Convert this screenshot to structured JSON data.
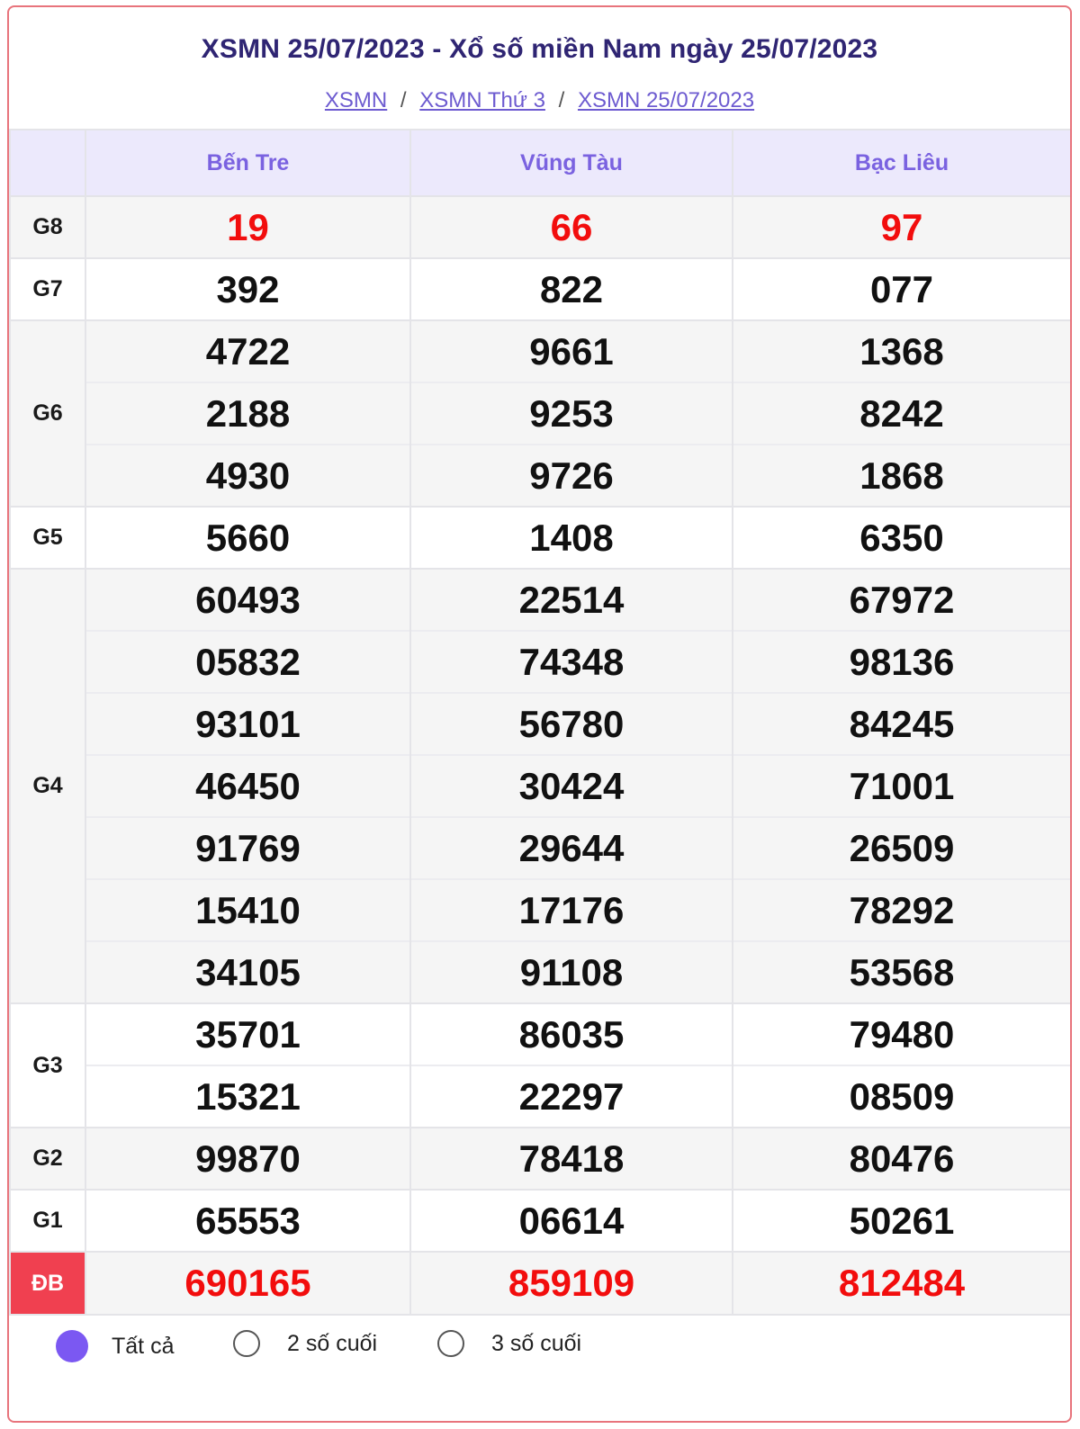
{
  "header": {
    "title": "XSMN 25/07/2023 - Xổ số miền Nam ngày 25/07/2023",
    "breadcrumb": [
      "XSMN",
      "XSMN Thứ 3",
      "XSMN 25/07/2023"
    ],
    "separator": "/"
  },
  "table": {
    "provinces": [
      "Bến Tre",
      "Vũng Tàu",
      "Bạc Liêu"
    ],
    "rows": [
      {
        "label": "G8",
        "red": true,
        "values": [
          [
            "19"
          ],
          [
            "66"
          ],
          [
            "97"
          ]
        ]
      },
      {
        "label": "G7",
        "values": [
          [
            "392"
          ],
          [
            "822"
          ],
          [
            "077"
          ]
        ]
      },
      {
        "label": "G6",
        "values": [
          [
            "4722",
            "2188",
            "4930"
          ],
          [
            "9661",
            "9253",
            "9726"
          ],
          [
            "1368",
            "8242",
            "1868"
          ]
        ]
      },
      {
        "label": "G5",
        "values": [
          [
            "5660"
          ],
          [
            "1408"
          ],
          [
            "6350"
          ]
        ]
      },
      {
        "label": "G4",
        "values": [
          [
            "60493",
            "05832",
            "93101",
            "46450",
            "91769",
            "15410",
            "34105"
          ],
          [
            "22514",
            "74348",
            "56780",
            "30424",
            "29644",
            "17176",
            "91108"
          ],
          [
            "67972",
            "98136",
            "84245",
            "71001",
            "26509",
            "78292",
            "53568"
          ]
        ]
      },
      {
        "label": "G3",
        "values": [
          [
            "35701",
            "15321"
          ],
          [
            "86035",
            "22297"
          ],
          [
            "79480",
            "08509"
          ]
        ]
      },
      {
        "label": "G2",
        "values": [
          [
            "99870"
          ],
          [
            "78418"
          ],
          [
            "80476"
          ]
        ]
      },
      {
        "label": "G1",
        "values": [
          [
            "65553"
          ],
          [
            "06614"
          ],
          [
            "50261"
          ]
        ]
      },
      {
        "label": "ĐB",
        "red": true,
        "special": true,
        "values": [
          [
            "690165"
          ],
          [
            "859109"
          ],
          [
            "812484"
          ]
        ]
      }
    ]
  },
  "options": {
    "items": [
      "Tất cả",
      "2 số cuối",
      "3 số cuối"
    ],
    "selected": 0,
    "accent": "#7b58f2"
  },
  "colors": {
    "title": "#2f2573",
    "link": "#6d5bd0",
    "red": "#f20d0d",
    "special_bg": "#f04050",
    "header_bg": "#ece9fc"
  }
}
